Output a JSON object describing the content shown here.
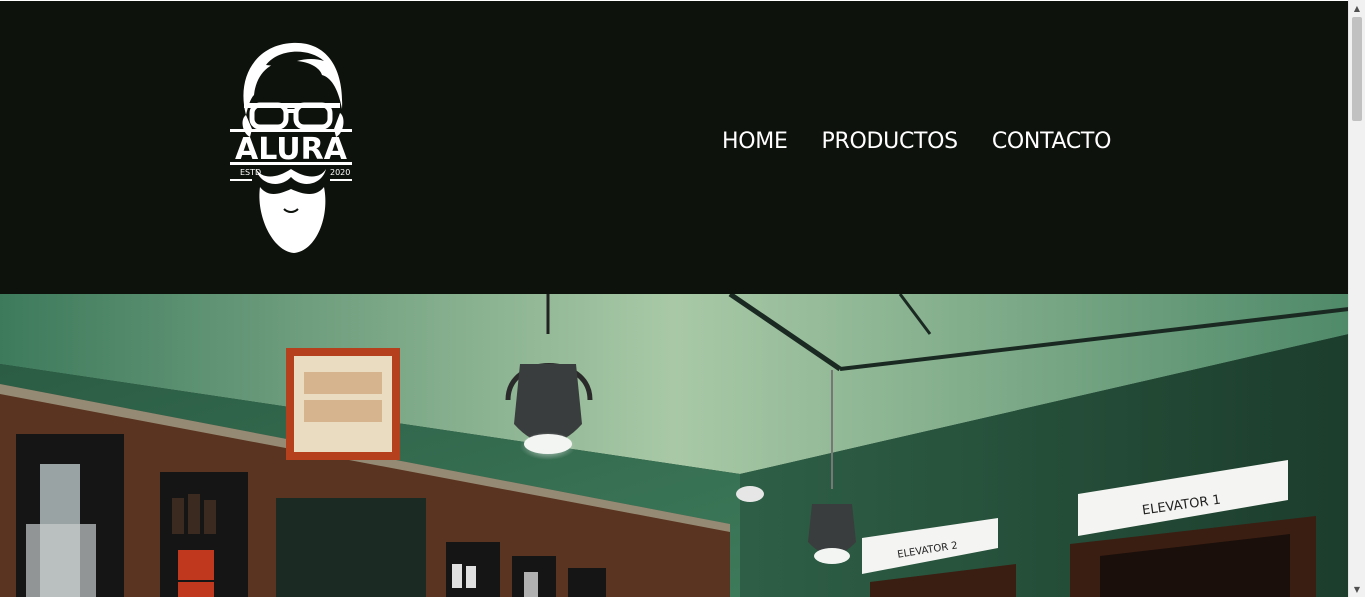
{
  "brand": {
    "logo_alt": "Alura barber logo",
    "name": "ALURA",
    "estd_label": "ESTD",
    "year": "2020"
  },
  "nav": {
    "items": [
      {
        "label": "HOME"
      },
      {
        "label": "PRODUCTOS"
      },
      {
        "label": "CONTACTO"
      }
    ]
  },
  "hero": {
    "sign_elevator_1": "ELEVATOR 1",
    "sign_elevator_2": "ELEVATOR 2"
  },
  "colors": {
    "header_bg": "#0e120c",
    "nav_text": "#ffffff",
    "wall_green": "#1f4a36",
    "wood": "#5a3420"
  }
}
